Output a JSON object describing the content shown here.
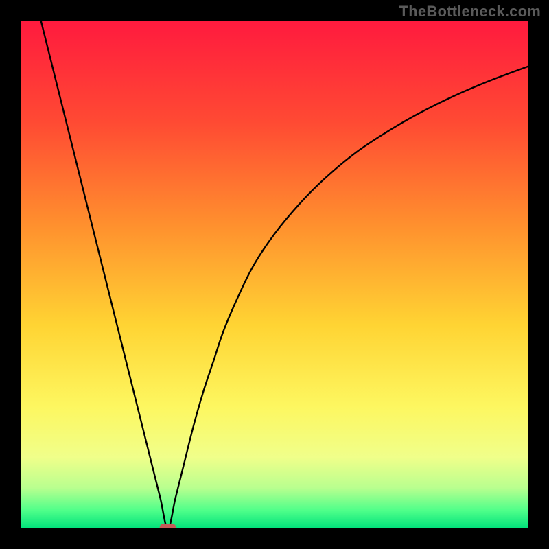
{
  "watermark": "TheBottleneck.com",
  "colors": {
    "frame": "#000000",
    "curve": "#000000",
    "marker_fill": "#c45a58",
    "watermark": "#5a5a5a",
    "gradient_stops": [
      {
        "offset": 0.0,
        "color": "#ff1a3e"
      },
      {
        "offset": 0.2,
        "color": "#ff4a33"
      },
      {
        "offset": 0.4,
        "color": "#ff8f2e"
      },
      {
        "offset": 0.6,
        "color": "#ffd433"
      },
      {
        "offset": 0.76,
        "color": "#fdf760"
      },
      {
        "offset": 0.86,
        "color": "#f0ff8a"
      },
      {
        "offset": 0.92,
        "color": "#b9ff8f"
      },
      {
        "offset": 0.965,
        "color": "#4eff8a"
      },
      {
        "offset": 1.0,
        "color": "#00e17a"
      }
    ]
  },
  "chart_data": {
    "type": "line",
    "title": "",
    "xlabel": "",
    "ylabel": "",
    "xlim": [
      0,
      100
    ],
    "ylim": [
      0,
      100
    ],
    "minimum_x": 29,
    "marker": {
      "x": 29,
      "y": 0
    },
    "series": [
      {
        "name": "curve",
        "x": [
          0,
          2,
          4,
          6,
          8,
          10,
          12,
          14,
          16,
          18,
          20,
          22,
          24,
          26,
          27.5,
          29,
          30.5,
          32,
          34,
          36,
          38,
          40,
          43,
          46,
          50,
          55,
          60,
          66,
          72,
          78,
          85,
          92,
          100
        ],
        "y": [
          118,
          108,
          100,
          92,
          84,
          76,
          68,
          60,
          52,
          44,
          36,
          28,
          20,
          12,
          6,
          0,
          6,
          12,
          20,
          27,
          33,
          39,
          46,
          52,
          58,
          64,
          69,
          74,
          78,
          81.5,
          85,
          88,
          91
        ]
      }
    ]
  }
}
